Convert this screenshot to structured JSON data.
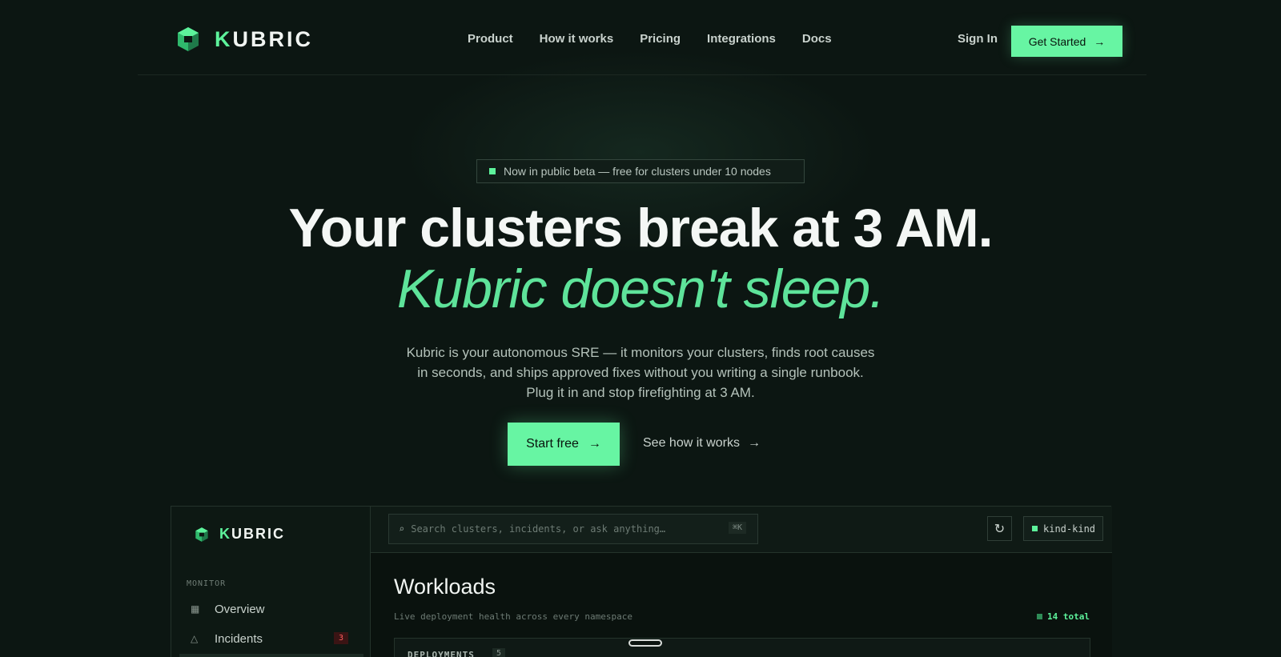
{
  "brand": {
    "name_first": "K",
    "name_rest": "UBRIC",
    "accent": "#5df29b",
    "background": "#0c1612"
  },
  "nav": {
    "links": [
      "Product",
      "How it works",
      "Pricing",
      "Integrations",
      "Docs"
    ],
    "signin": "Sign In",
    "cta": "Get Started",
    "cta_arrow": "→"
  },
  "hero": {
    "badge": "Now in public beta — free for clusters under 10 nodes",
    "headline": "Your clusters break at 3 AM.",
    "headline_accent": "Kubric doesn't sleep.",
    "sub_lines": [
      "Kubric is your autonomous SRE — it monitors your clusters, finds root causes",
      "in seconds, and ships approved fixes without you writing a single runbook.",
      "Plug it in and stop firefighting at 3 AM."
    ],
    "primary_cta": "Start free",
    "secondary_cta": "See how it works",
    "arrow": "→"
  },
  "app": {
    "sidebar": {
      "section": "MONITOR",
      "items": [
        {
          "label": "Overview",
          "icon": "grid-icon",
          "glyph": "▦"
        },
        {
          "label": "Incidents",
          "icon": "triangle-icon",
          "glyph": "△",
          "count": "3"
        }
      ]
    },
    "search": {
      "placeholder": "Search clusters, incidents, or ask anything…",
      "shortcut": "⌘K",
      "icon": "⌕"
    },
    "refresh_icon": "↻",
    "context": "kind-kind",
    "workloads": {
      "title": "Workloads",
      "subtitle": "Live deployment health across every namespace",
      "total": "14 total",
      "deployments_label": "DEPLOYMENTS",
      "deployments_count": "5"
    }
  }
}
